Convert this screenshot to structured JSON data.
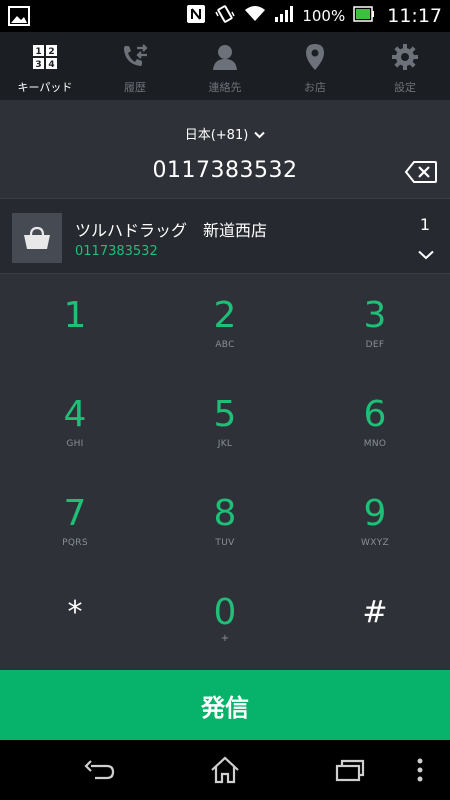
{
  "status_bar": {
    "battery_percent": "100%",
    "time": "11:17",
    "icons": [
      "gallery-icon",
      "nfc-icon",
      "vibrate-icon",
      "wifi-icon",
      "signal-icon",
      "battery-icon"
    ]
  },
  "tabs": [
    {
      "label": "キーパッド",
      "icon": "keypad-icon",
      "active": true
    },
    {
      "label": "履歴",
      "icon": "history-icon",
      "active": false
    },
    {
      "label": "連絡先",
      "icon": "contacts-icon",
      "active": false
    },
    {
      "label": "お店",
      "icon": "location-pin-icon",
      "active": false
    },
    {
      "label": "設定",
      "icon": "gear-icon",
      "active": false
    }
  ],
  "dialer": {
    "country": "日本(+81)",
    "number": "0117383532"
  },
  "suggestion": {
    "name": "ツルハドラッグ　新道西店",
    "number": "0117383532",
    "count": "1"
  },
  "keypad": [
    {
      "digit": "1",
      "letters": ""
    },
    {
      "digit": "2",
      "letters": "ABC"
    },
    {
      "digit": "3",
      "letters": "DEF"
    },
    {
      "digit": "4",
      "letters": "GHI"
    },
    {
      "digit": "5",
      "letters": "JKL"
    },
    {
      "digit": "6",
      "letters": "MNO"
    },
    {
      "digit": "7",
      "letters": "PQRS"
    },
    {
      "digit": "8",
      "letters": "TUV"
    },
    {
      "digit": "9",
      "letters": "WXYZ"
    },
    {
      "digit": "*",
      "letters": ""
    },
    {
      "digit": "0",
      "letters": "+"
    },
    {
      "digit": "#",
      "letters": ""
    }
  ],
  "call_label": "発信",
  "colors": {
    "accent": "#1fbf78",
    "call_button": "#07b26a",
    "background": "#2e3138",
    "tab_bar": "#1b1e23"
  }
}
